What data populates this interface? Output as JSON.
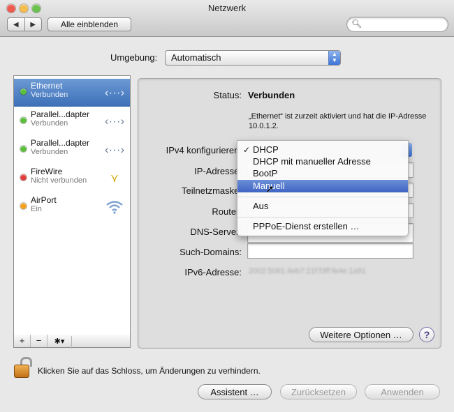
{
  "window": {
    "title": "Netzwerk"
  },
  "toolbar": {
    "back_glyph": "◀",
    "forward_glyph": "▶",
    "show_all_label": "Alle einblenden",
    "search_placeholder": ""
  },
  "environment": {
    "label": "Umgebung:",
    "value": "Automatisch"
  },
  "services": [
    {
      "name": "Ethernet",
      "status": "Verbunden",
      "dot_color": "#5bbf3b",
      "icon": "ethernet-arrows-icon",
      "selected": true
    },
    {
      "name": "Parallel...dapter",
      "status": "Verbunden",
      "dot_color": "#5bbf3b",
      "icon": "ethernet-arrows-icon",
      "selected": false
    },
    {
      "name": "Parallel...dapter",
      "status": "Verbunden",
      "dot_color": "#5bbf3b",
      "icon": "ethernet-arrows-icon",
      "selected": false
    },
    {
      "name": "FireWire",
      "status": "Nicht verbunden",
      "dot_color": "#e23b3b",
      "icon": "firewire-icon",
      "selected": false
    },
    {
      "name": "AirPort",
      "status": "Ein",
      "dot_color": "#f4a11c",
      "icon": "wifi-icon",
      "selected": false
    }
  ],
  "sidebar_tools": {
    "add": "+",
    "remove": "−",
    "gear": "✱▾"
  },
  "detail": {
    "status_label": "Status:",
    "status_value": "Verbunden",
    "status_description": "„Ethernet“ ist zurzeit aktiviert und hat die IP-Adresse 10.0.1.2.",
    "ipv4_label": "IPv4 konfigurieren:",
    "ip_label": "IP-Adresse:",
    "subnet_label": "Teilnetzmaske:",
    "router_label": "Router:",
    "dns_label": "DNS-Server:",
    "search_domains_label": "Such-Domains:",
    "ipv6_label": "IPv6-Adresse:",
    "ipv6_value": "2002:5081:4eb7:21f:f3ff:fe4e:1a91",
    "more_options_label": "Weitere Optionen …",
    "help_label": "?"
  },
  "ipv4_menu": {
    "check_glyph": "✓",
    "items": [
      {
        "label": "DHCP",
        "checked": true,
        "highlighted": false
      },
      {
        "label": "DHCP mit manueller Adresse",
        "checked": false,
        "highlighted": false
      },
      {
        "label": "BootP",
        "checked": false,
        "highlighted": false
      },
      {
        "label": "Manuell",
        "checked": false,
        "highlighted": true
      },
      {
        "label": "Aus",
        "checked": false,
        "highlighted": false
      },
      {
        "label": "PPPoE-Dienst erstellen …",
        "checked": false,
        "highlighted": false
      }
    ]
  },
  "footer": {
    "lock_text": "Klicken Sie auf das Schloss, um Änderungen zu verhindern.",
    "assistant_label": "Assistent …",
    "revert_label": "Zurücksetzen",
    "apply_label": "Anwenden"
  },
  "colors": {
    "close": "#ee5b4f",
    "minimize": "#f5bd4f",
    "zoom": "#6dc14f",
    "selection": "#3c6fb8",
    "menu_highlight": "#3f64c3"
  }
}
